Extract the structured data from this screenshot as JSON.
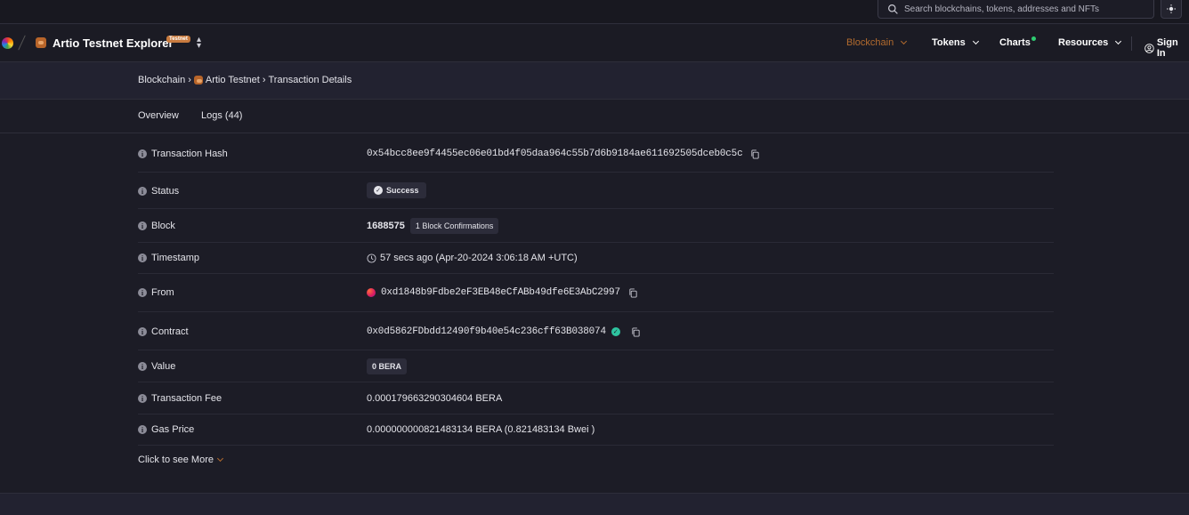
{
  "search": {
    "placeholder": "Search blockchains, tokens, addresses and NFTs"
  },
  "brand": {
    "title": "Artio Testnet Explorer",
    "badge": "Testnet"
  },
  "nav": {
    "blockchain": "Blockchain",
    "tokens": "Tokens",
    "charts": "Charts",
    "resources": "Resources",
    "sign_in": "Sign In"
  },
  "breadcrumb": {
    "root": "Blockchain",
    "sep": "›",
    "network": "Artio Testnet",
    "page": "Transaction Details"
  },
  "tabs": {
    "overview": "Overview",
    "logs": "Logs (44)"
  },
  "tx": {
    "hash": {
      "label": "Transaction Hash",
      "value": "0x54bcc8ee9f4455ec06e01bd4f05daa964c55b7d6b9184ae611692505dceb0c5c"
    },
    "status": {
      "label": "Status",
      "value": "Success"
    },
    "block": {
      "label": "Block",
      "value": "1688575",
      "confirmations": "1 Block Confirmations"
    },
    "timestamp": {
      "label": "Timestamp",
      "value": "57 secs ago (Apr-20-2024 3:06:18 AM +UTC)"
    },
    "from": {
      "label": "From",
      "value": "0xd1848b9Fdbe2eF3EB48eCfABb49dfe6E3AbC2997"
    },
    "contract": {
      "label": "Contract",
      "value": "0x0d5862FDbdd12490f9b40e54c236cff63B038074"
    },
    "value": {
      "label": "Value",
      "value": "0 BERA"
    },
    "fee": {
      "label": "Transaction Fee",
      "value": "0.000179663290304604 BERA"
    },
    "gas_price": {
      "label": "Gas Price",
      "value": "0.000000000821483134 BERA (0.821483134 Bwei )"
    }
  },
  "see_more": "Click to see More",
  "colors": {
    "accent": "#b36b2e",
    "success": "#2ec4a0",
    "background": "#1c1c26"
  }
}
